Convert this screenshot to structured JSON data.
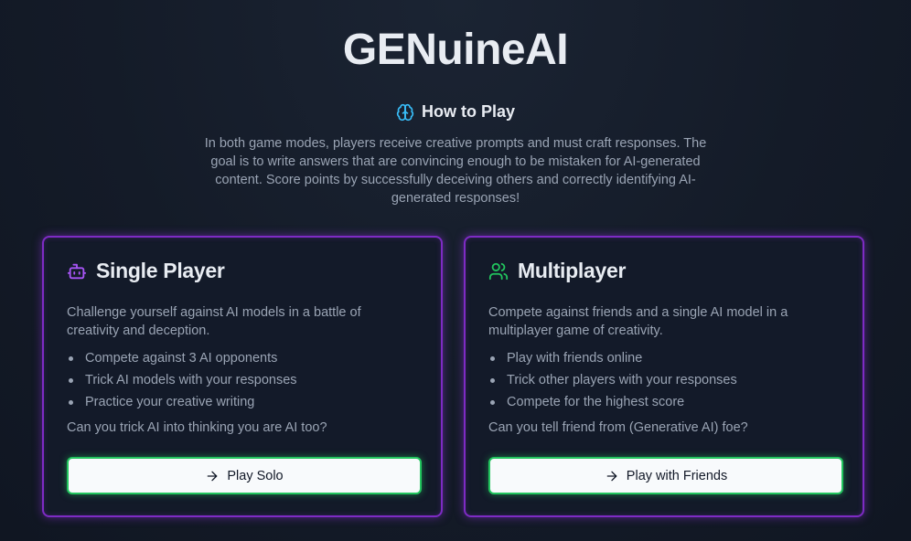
{
  "app": {
    "title": "GENuineAI"
  },
  "how_to_play": {
    "icon": "brain-icon",
    "icon_color": "#38bdf8",
    "heading": "How to Play",
    "description": "In both game modes, players receive creative prompts and must craft responses. The goal is to write answers that are convincing enough to be mistaken for AI-generated content. Score points by successfully deceiving others and correctly identifying AI-generated responses!"
  },
  "modes": {
    "single": {
      "icon": "bot-icon",
      "icon_color": "#a855f7",
      "title": "Single Player",
      "description": "Challenge yourself against AI models in a battle of creativity and deception.",
      "features": [
        "Compete against 3 AI opponents",
        "Trick AI models with your responses",
        "Practice your creative writing"
      ],
      "question": "Can you trick AI into thinking you are AI too?",
      "button_label": "Play Solo",
      "button_icon": "arrow-right-icon"
    },
    "multi": {
      "icon": "users-icon",
      "icon_color": "#22c55e",
      "title": "Multiplayer",
      "description": "Compete against friends and a single AI model in a multiplayer game of creativity.",
      "features": [
        "Play with friends online",
        "Trick other players with your responses",
        "Compete for the highest score"
      ],
      "question": "Can you tell friend from (Generative AI) foe?",
      "button_label": "Play with Friends",
      "button_icon": "arrow-right-icon"
    }
  },
  "colors": {
    "card_border": "#7e2bc4",
    "button_border": "#22c55e",
    "background": "#141b28"
  }
}
